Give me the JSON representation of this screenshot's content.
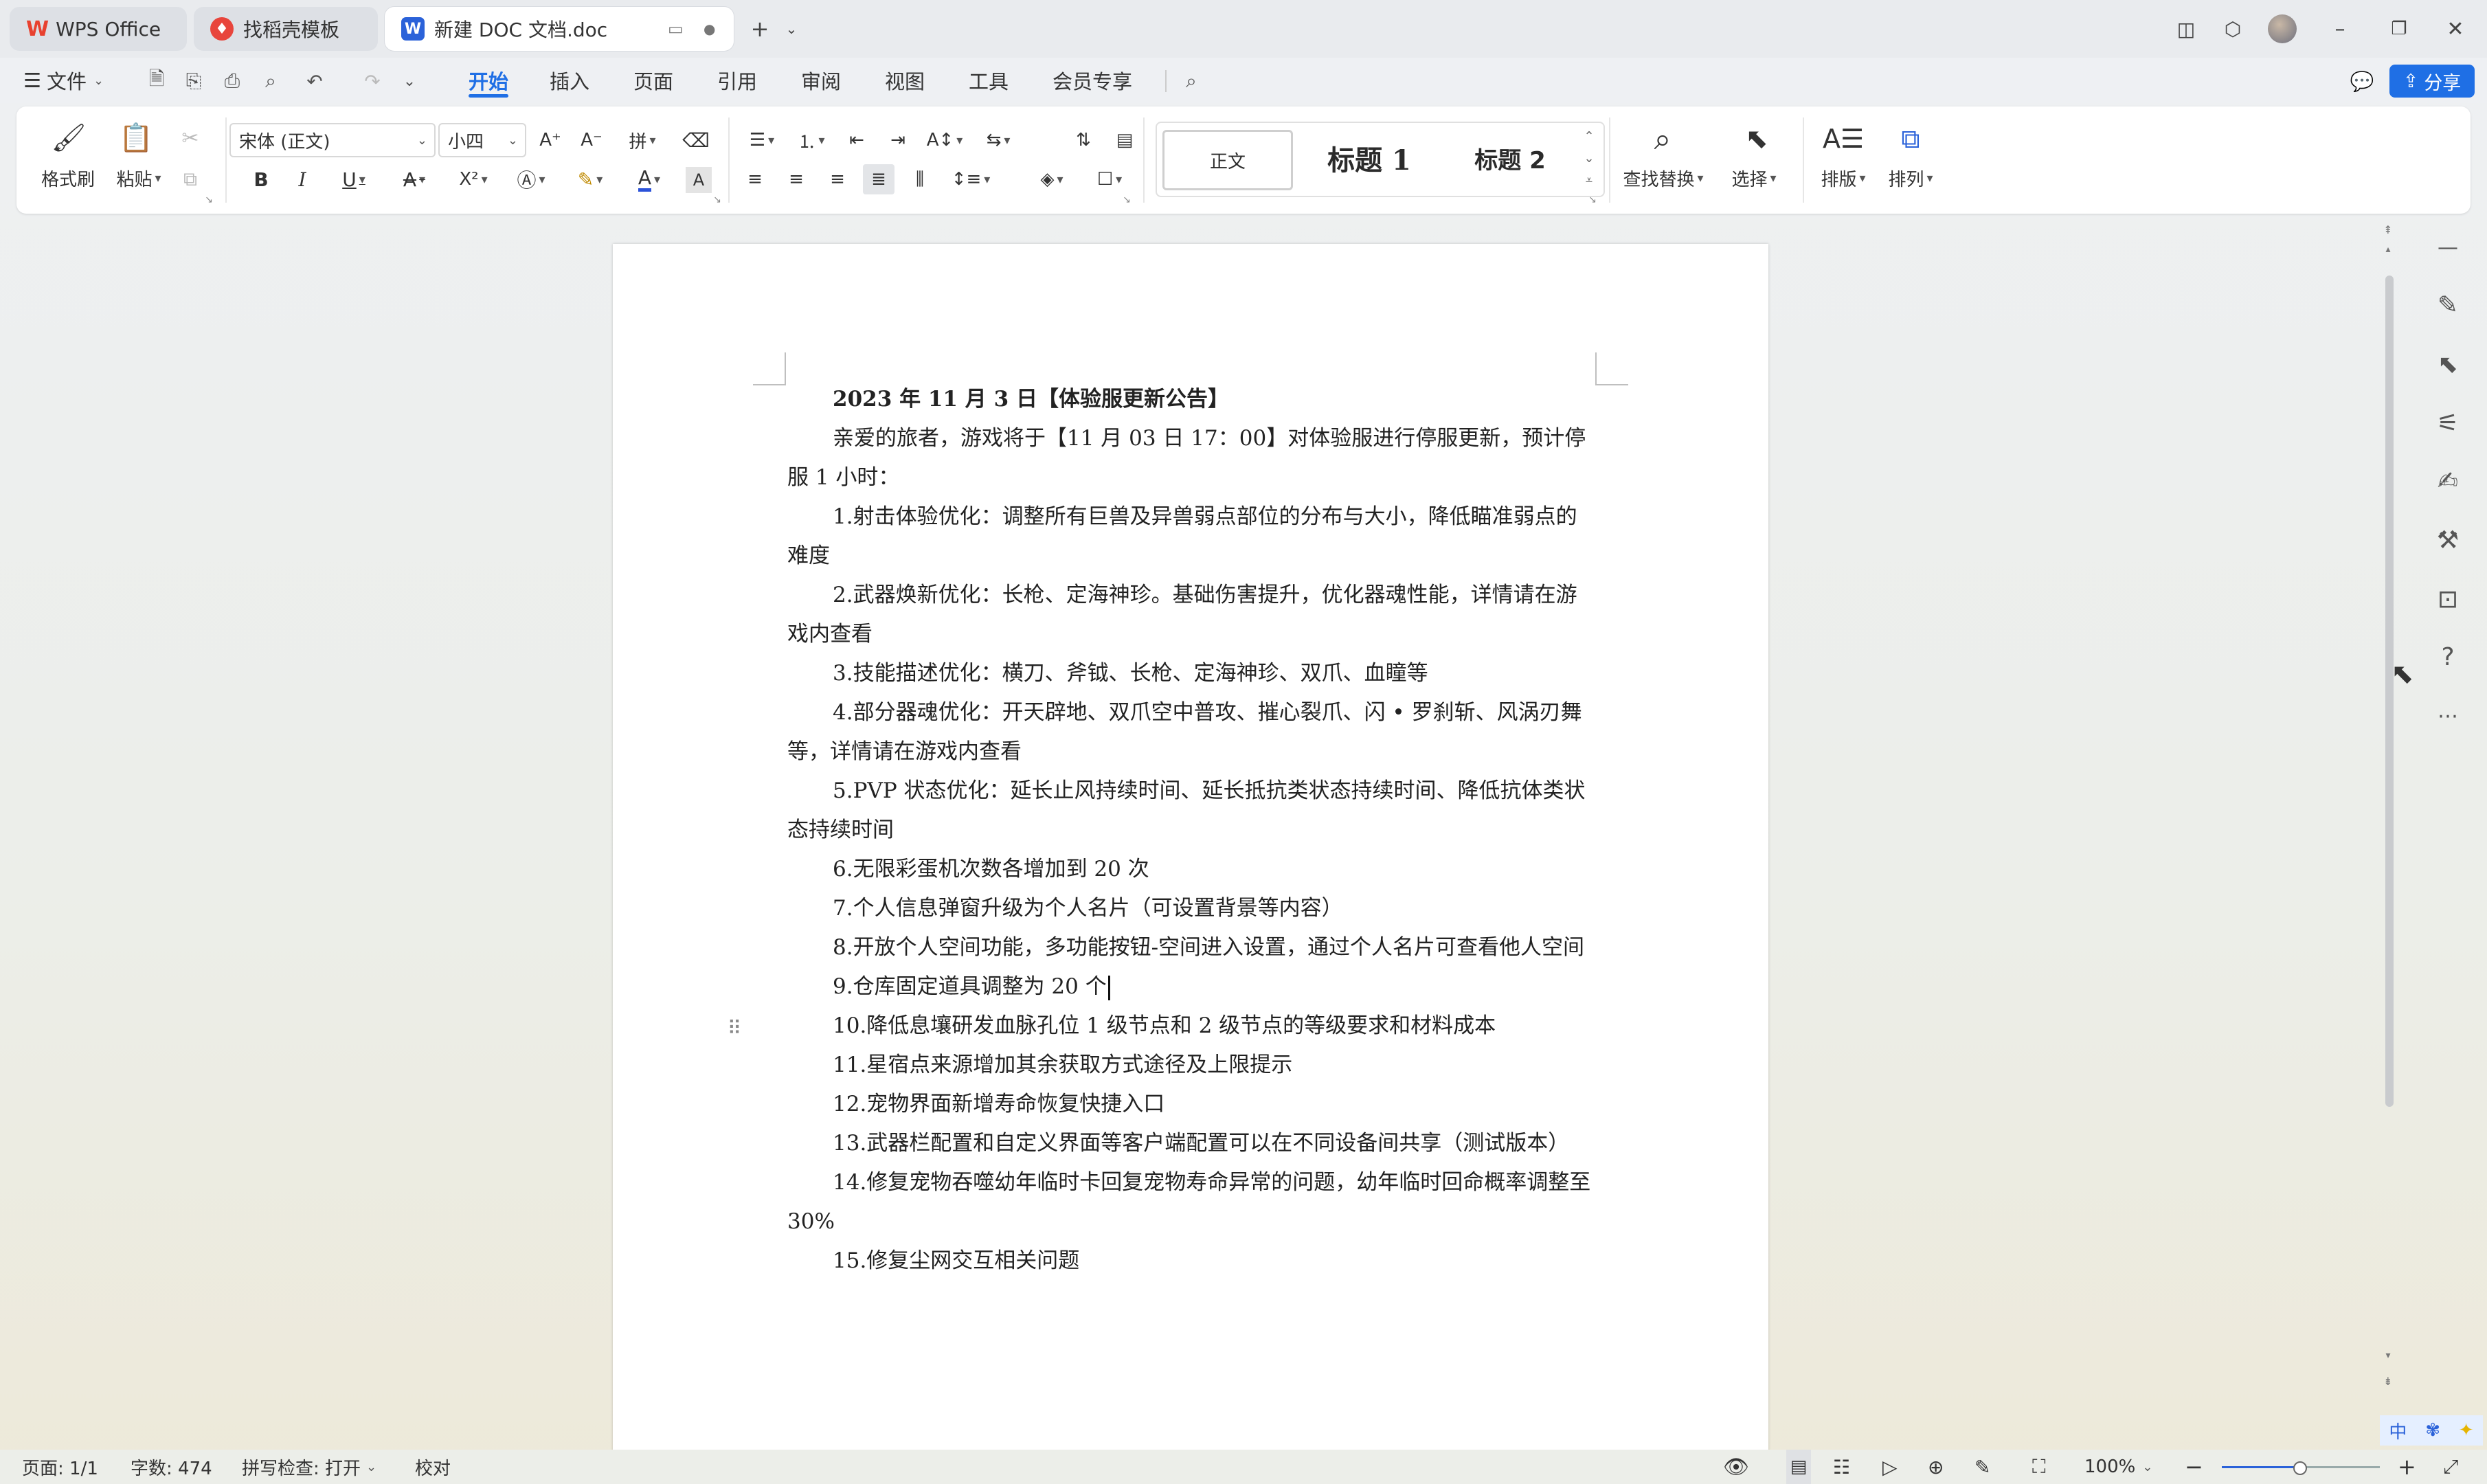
{
  "titlebar": {
    "tabs": [
      {
        "label": "WPS Office",
        "icon": "wps-logo-icon",
        "active": false
      },
      {
        "label": "找稻壳模板",
        "icon": "docer-icon",
        "active": false
      },
      {
        "label": "新建 DOC 文档.doc",
        "icon": "word-doc-icon",
        "active": true
      }
    ],
    "new_tab": "+"
  },
  "menubar": {
    "file_label": "文件",
    "items": [
      "开始",
      "插入",
      "页面",
      "引用",
      "审阅",
      "视图",
      "工具",
      "会员专享"
    ],
    "active_item": "开始",
    "share_label": "分享"
  },
  "ribbon": {
    "format_painter": "格式刷",
    "paste": "粘贴",
    "font_name": "宋体 (正文)",
    "font_size": "小四",
    "styles": [
      "正文",
      "标题 1",
      "标题 2"
    ],
    "find_replace": "查找替换",
    "select": "选择",
    "layout": "排版",
    "arrange": "排列"
  },
  "document": {
    "paragraphs": [
      "2023 年 11 月 3 日【体验服更新公告】",
      "亲爱的旅者，游戏将于【11 月 03 日 17：00】对体验服进行停服更新，预计停服 1 小时：",
      "1.射击体验优化：调整所有巨兽及异兽弱点部位的分布与大小，降低瞄准弱点的难度",
      "2.武器焕新优化：长枪、定海神珍。基础伤害提升，优化器魂性能，详情请在游戏内查看",
      "3.技能描述优化：横刀、斧钺、长枪、定海神珍、双爪、血瞳等",
      "4.部分器魂优化：开天辟地、双爪空中普攻、摧心裂爪、闪 • 罗刹斩、风涡刃舞等，详情请在游戏内查看",
      "5.PVP 状态优化：延长止风持续时间、延长抵抗类状态持续时间、降低抗体类状态持续时间",
      "6.无限彩蛋机次数各增加到 20 次",
      "7.个人信息弹窗升级为个人名片（可设置背景等内容）",
      "8.开放个人空间功能，多功能按钮-空间进入设置，通过个人名片可查看他人空间",
      "9.仓库固定道具调整为 20 个",
      "10.降低息壤研发血脉孔位 1 级节点和 2 级节点的等级要求和材料成本",
      "11.星宿点来源增加其余获取方式途径及上限提示",
      "12.宠物界面新增寿命恢复快捷入口",
      "13.武器栏配置和自定义界面等客户端配置可以在不同设备间共享（测试版本）",
      "14.修复宠物吞噬幼年临时卡回复宠物寿命异常的问题，幼年临时回命概率调整至 30%",
      "15.修复尘网交互相关问题"
    ]
  },
  "ime": {
    "label": "中"
  },
  "statusbar": {
    "page": "页面: 1/1",
    "words": "字数: 474",
    "spellcheck": "拼写检查: 打开",
    "proofread": "校对",
    "zoom": "100%"
  },
  "colors": {
    "accent": "#1f6fe5",
    "wps_red": "#e8412f",
    "docer_red": "#e8453c",
    "word_blue": "#2b62d9"
  }
}
